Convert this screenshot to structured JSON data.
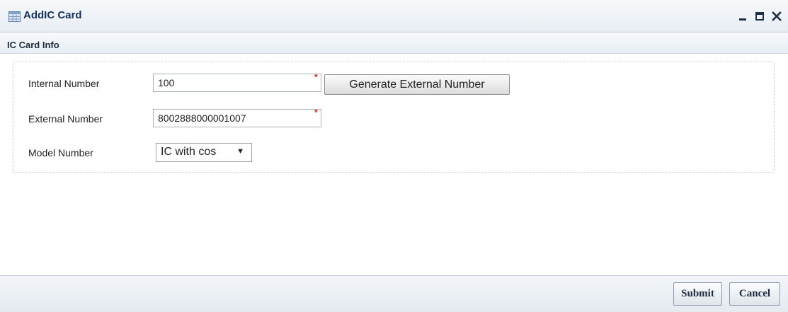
{
  "window": {
    "title": "AddIC Card",
    "controls": [
      "minimize-icon",
      "maximize-icon",
      "close-icon"
    ]
  },
  "section": {
    "title": "IC Card Info"
  },
  "form": {
    "internal_number": {
      "label": "Internal Number",
      "value": "100",
      "required_mark": "*"
    },
    "generate_button": {
      "label": "Generate External Number"
    },
    "external_number": {
      "label": "External Number",
      "value": "8002888000001007",
      "required_mark": "*"
    },
    "model_number": {
      "label": "Model Number",
      "selected": "IC with cos"
    }
  },
  "footer": {
    "submit_label": "Submit",
    "cancel_label": "Cancel"
  },
  "colors": {
    "title_text": "#15315a",
    "required": "#e01a1a",
    "titlebar_bg": "#e7edf3"
  }
}
